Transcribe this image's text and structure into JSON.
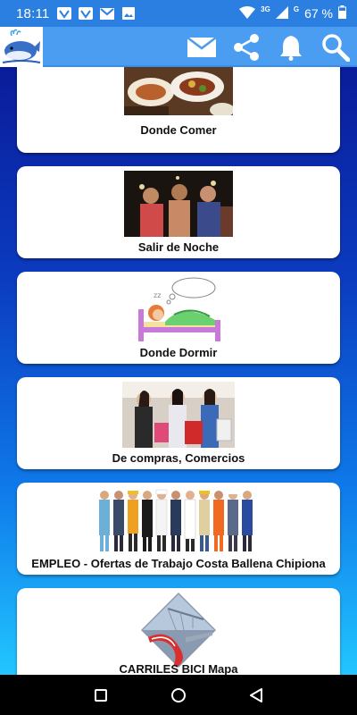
{
  "status_bar": {
    "time": "18:11",
    "network": "3G",
    "signal_badge": "G",
    "battery": "67 %"
  },
  "app_bar": {
    "icons": [
      "whale-logo-icon",
      "mail-icon",
      "share-icon",
      "bell-icon",
      "search-icon"
    ]
  },
  "cards": [
    {
      "label": "Donde Comer",
      "icon": "food-image"
    },
    {
      "label": "Salir de Noche",
      "icon": "nightlife-image"
    },
    {
      "label": "Donde Dormir",
      "icon": "sleeping-image"
    },
    {
      "label": "De compras, Comercios",
      "icon": "shopping-image"
    },
    {
      "label": "EMPLEO - Ofertas de Trabajo Costa Ballena Chipiona",
      "icon": "workers-image"
    },
    {
      "label": "CARRILES BICI  Mapa",
      "icon": "bike-lane-image"
    }
  ],
  "colors": {
    "status_bar": "#2a7fe0",
    "app_bar": "#4a9df0",
    "gradient_top": "#0a1c9a",
    "gradient_bottom": "#22c6ff"
  }
}
